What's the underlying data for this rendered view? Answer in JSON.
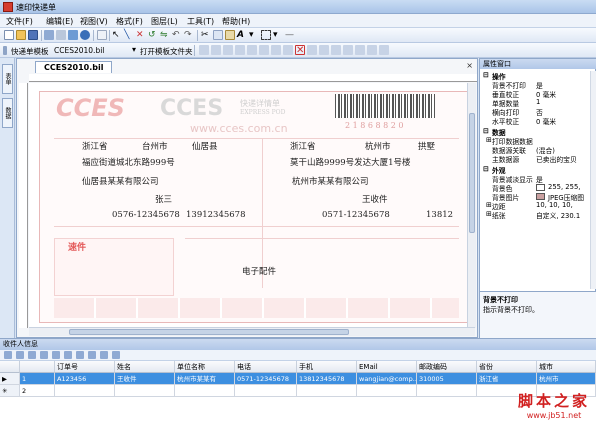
{
  "window": {
    "title": "速印快递单"
  },
  "menu": [
    "文件(F)",
    "编辑(E)",
    "视图(V)",
    "格式(F)",
    "图层(L)",
    "工具(T)",
    "帮助(H)"
  ],
  "toolbar2": {
    "template_label": "快递单模板",
    "template_value": "CCES2010.bil",
    "open_folder": "打开模板文件夹"
  },
  "left_tabs": [
    "表单",
    "数据"
  ],
  "doc": {
    "tab_label": "CCES2010.bil",
    "close": "×",
    "slip": {
      "logo": "CCES",
      "logo_cn": "快递详情单",
      "logo_en": "EXPRESS POD",
      "website": "www.cces.com.cn",
      "barcode_num": "2 1 8 6 8 8 2 0",
      "sender_province": "浙江省",
      "sender_city": "台州市",
      "sender_county": "仙居县",
      "sender_address": "福应街道城北东路999号",
      "sender_company": "仙居县某某有限公司",
      "sender_name": "张三",
      "sender_phone": "0576-12345678",
      "sender_mobile": "13912345678",
      "recv_province": "浙江省",
      "recv_city": "杭州市",
      "recv_district": "拱墅",
      "recv_address": "莫干山路9999号发达大厦1号楼",
      "recv_company": "杭州市某某有限公司",
      "recv_name": "王收件",
      "recv_phone": "0571-12345678",
      "recv_mobile": "13812",
      "goods": "电子配件",
      "stamp_text": "速件"
    }
  },
  "props": {
    "header": "属性窗口",
    "groups": [
      {
        "name": "操作",
        "rows": [
          [
            "背景不打印",
            "是"
          ],
          [
            "垂直校正",
            "0 毫米"
          ],
          [
            "单据数量",
            "1"
          ],
          [
            "横向打印",
            "否"
          ],
          [
            "水平校正",
            "0 毫米"
          ]
        ]
      },
      {
        "name": "数据",
        "rows": [
          [
            "打印数据数据",
            ""
          ],
          [
            "数据源关联",
            "(混合)"
          ],
          [
            "主数据源",
            "已卖出的宝贝"
          ]
        ]
      },
      {
        "name": "外观",
        "rows": [
          [
            "背景减淡显示",
            "是"
          ],
          [
            "背景色",
            "255, 255,"
          ],
          [
            "背景图片",
            "JPEG压缩图"
          ],
          [
            "边距",
            "10, 10, 10,"
          ],
          [
            "纸张",
            "自定义, 230.1"
          ]
        ]
      }
    ],
    "desc_title": "背景不打印",
    "desc_text": "指示背景不打印。"
  },
  "recipients": {
    "header": "收件人信息",
    "columns": [
      "订单号",
      "姓名",
      "单位名称",
      "电话",
      "手机",
      "EMail",
      "邮政编码",
      "省份",
      "城市"
    ],
    "rows": [
      {
        "num": "1",
        "cells": [
          "A123456",
          "王收件",
          "杭州市某某有",
          "0571-12345678",
          "13812345678",
          "wangjian@comp...",
          "310005",
          "浙江省",
          "杭州市"
        ]
      },
      {
        "num": "2",
        "cells": [
          "",
          "",
          "",
          "",
          "",
          "",
          "",
          "",
          ""
        ]
      }
    ]
  },
  "watermark": {
    "line1": "脚本之家",
    "line2": "www.jb51.net"
  },
  "colors": {
    "accent": "#3d8fe0",
    "stamp_red": "#e45a5a",
    "frame_blue": "#8fa7c9"
  }
}
